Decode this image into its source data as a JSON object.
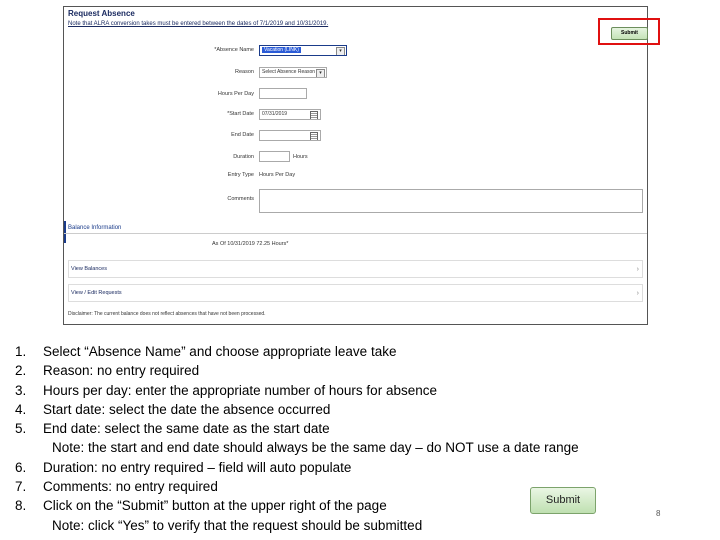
{
  "screenshot": {
    "title": "Request Absence",
    "note": "Note that ALRA conversion takes must be entered between the dates of 7/1/2019 and 10/31/2019.",
    "submit_label": "Submit",
    "fields": {
      "absence_name_label": "*Absence Name",
      "absence_name_value": "Vacation (LINK)",
      "reason_label": "Reason",
      "reason_value": "Select Absence Reason",
      "hours_per_day_label": "Hours Per Day",
      "start_date_label": "*Start Date",
      "start_date_value": "07/31/2019",
      "end_date_label": "End Date",
      "duration_label": "Duration",
      "duration_unit": "Hours",
      "entry_type_label": "Entry Type",
      "entry_type_value": "Hours Per Day",
      "comments_label": "Comments"
    },
    "balance": {
      "title": "Balance Information",
      "as_of": "As Of 10/31/2019   72.25 Hours*",
      "view_balances": "View Balances",
      "view_edit_requests": "View / Edit Requests",
      "disclaimer": "Disclaimer: The current balance does not reflect absences that have not been processed."
    }
  },
  "instructions": [
    {
      "num": "1.",
      "text": "Select “Absence Name” and choose appropriate leave take"
    },
    {
      "num": "2.",
      "text": "Reason: no entry required"
    },
    {
      "num": "3.",
      "text": "Hours per day: enter the appropriate number of hours for absence"
    },
    {
      "num": "4.",
      "text": "Start date: select the date the absence occurred"
    },
    {
      "num": "5.",
      "text": "End date: select the same date as the start date"
    },
    {
      "num": "6.",
      "text": "Duration: no entry required – field will auto populate"
    },
    {
      "num": "7.",
      "text": "Comments: no entry required"
    },
    {
      "num": "8.",
      "text": "Click on the “Submit” button at the upper right of the page"
    }
  ],
  "notes": {
    "note5_label": "Note:",
    "note5_text": " the start and end date should always be the same day – do NOT use a date range",
    "note8_label": "Note:",
    "note8_text": " click “Yes” to verify that the request should be submitted"
  },
  "submit_button_label": "Submit",
  "page_number": "8",
  "colors": {
    "highlight": "#e01010",
    "submit_green": "#c4e3b7",
    "link_blue": "#1a2a60"
  }
}
